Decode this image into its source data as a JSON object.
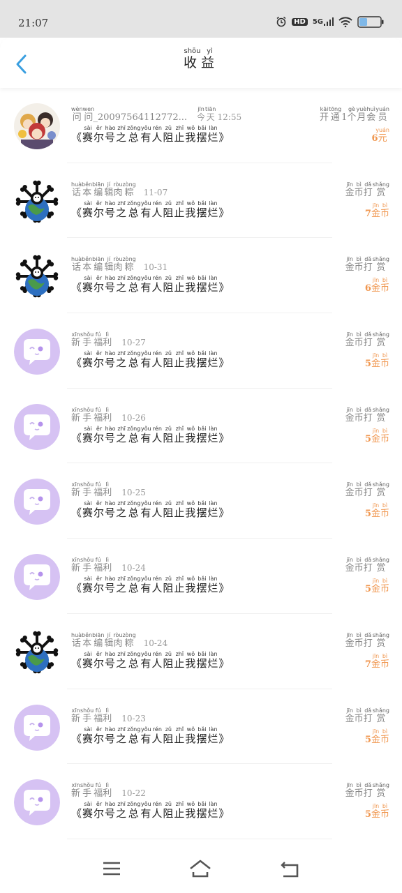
{
  "status": {
    "time": "21:07",
    "network": "5G",
    "hd": "HD"
  },
  "header": {
    "title_chars": [
      {
        "c": "收",
        "p": "shōu"
      },
      {
        "c": "益",
        "p": "yì"
      }
    ]
  },
  "book_title_chars": [
    {
      "c": "赛",
      "p": "sài"
    },
    {
      "c": "尔",
      "p": "ěr"
    },
    {
      "c": "号",
      "p": "hào"
    },
    {
      "c": "之",
      "p": "zhī"
    },
    {
      "c": "总",
      "p": "zǒng"
    },
    {
      "c": "有",
      "p": "yǒu"
    },
    {
      "c": "人",
      "p": "rén"
    },
    {
      "c": "阻",
      "p": "zǔ"
    },
    {
      "c": "止",
      "p": "zhǐ"
    },
    {
      "c": "我",
      "p": "wǒ"
    },
    {
      "c": "摆",
      "p": "bǎi"
    },
    {
      "c": "烂",
      "p": "làn"
    }
  ],
  "items": [
    {
      "avatar": "anime-group",
      "source": [
        {
          "c": "问",
          "p": "wèn"
        },
        {
          "c": "问",
          "p": "wen"
        }
      ],
      "source_suffix": "_20097564112772...",
      "time_ruby": [
        {
          "c": "今",
          "p": "jīn"
        },
        {
          "c": "天",
          "p": "tiān"
        }
      ],
      "time": "12:55",
      "type": [
        {
          "c": "开",
          "p": "kāi"
        },
        {
          "c": "通",
          "p": "tōng"
        },
        {
          "c": "1",
          "p": ""
        },
        {
          "c": "个",
          "p": "gè"
        },
        {
          "c": "月",
          "p": "yuè"
        },
        {
          "c": "会",
          "p": "huì"
        },
        {
          "c": "员",
          "p": "yuán"
        }
      ],
      "amount": "6",
      "unit": [
        {
          "c": "元",
          "p": "yuán"
        }
      ]
    },
    {
      "avatar": "bone-earth",
      "source": [
        {
          "c": "话",
          "p": "huà"
        },
        {
          "c": "本",
          "p": "běn"
        },
        {
          "c": "编",
          "p": "biān"
        },
        {
          "c": "辑",
          "p": "jí"
        },
        {
          "c": "肉",
          "p": "ròu"
        },
        {
          "c": "粽",
          "p": "zòng"
        }
      ],
      "source_suffix": "",
      "time_ruby": [],
      "time": "11-07",
      "type": [
        {
          "c": "金",
          "p": "jīn"
        },
        {
          "c": "币",
          "p": "bì"
        },
        {
          "c": "打",
          "p": "dǎ"
        },
        {
          "c": "赏",
          "p": "shǎng"
        }
      ],
      "amount": "7",
      "unit": [
        {
          "c": "金",
          "p": "jīn"
        },
        {
          "c": "币",
          "p": "bì"
        }
      ]
    },
    {
      "avatar": "bone-earth",
      "source": [
        {
          "c": "话",
          "p": "huà"
        },
        {
          "c": "本",
          "p": "běn"
        },
        {
          "c": "编",
          "p": "biān"
        },
        {
          "c": "辑",
          "p": "jí"
        },
        {
          "c": "肉",
          "p": "ròu"
        },
        {
          "c": "粽",
          "p": "zòng"
        }
      ],
      "source_suffix": "",
      "time_ruby": [],
      "time": "10-31",
      "type": [
        {
          "c": "金",
          "p": "jīn"
        },
        {
          "c": "币",
          "p": "bì"
        },
        {
          "c": "打",
          "p": "dǎ"
        },
        {
          "c": "赏",
          "p": "shǎng"
        }
      ],
      "amount": "6",
      "unit": [
        {
          "c": "金",
          "p": "jīn"
        },
        {
          "c": "币",
          "p": "bì"
        }
      ]
    },
    {
      "avatar": "purple-chat",
      "source": [
        {
          "c": "新",
          "p": "xīn"
        },
        {
          "c": "手",
          "p": "shǒu"
        },
        {
          "c": "福",
          "p": "fú"
        },
        {
          "c": "利",
          "p": "lì"
        }
      ],
      "source_suffix": "",
      "time_ruby": [],
      "time": "10-27",
      "type": [
        {
          "c": "金",
          "p": "jīn"
        },
        {
          "c": "币",
          "p": "bì"
        },
        {
          "c": "打",
          "p": "dǎ"
        },
        {
          "c": "赏",
          "p": "shǎng"
        }
      ],
      "amount": "5",
      "unit": [
        {
          "c": "金",
          "p": "jīn"
        },
        {
          "c": "币",
          "p": "bì"
        }
      ]
    },
    {
      "avatar": "purple-chat",
      "source": [
        {
          "c": "新",
          "p": "xīn"
        },
        {
          "c": "手",
          "p": "shǒu"
        },
        {
          "c": "福",
          "p": "fú"
        },
        {
          "c": "利",
          "p": "lì"
        }
      ],
      "source_suffix": "",
      "time_ruby": [],
      "time": "10-26",
      "type": [
        {
          "c": "金",
          "p": "jīn"
        },
        {
          "c": "币",
          "p": "bì"
        },
        {
          "c": "打",
          "p": "dǎ"
        },
        {
          "c": "赏",
          "p": "shǎng"
        }
      ],
      "amount": "5",
      "unit": [
        {
          "c": "金",
          "p": "jīn"
        },
        {
          "c": "币",
          "p": "bì"
        }
      ]
    },
    {
      "avatar": "purple-chat",
      "source": [
        {
          "c": "新",
          "p": "xīn"
        },
        {
          "c": "手",
          "p": "shǒu"
        },
        {
          "c": "福",
          "p": "fú"
        },
        {
          "c": "利",
          "p": "lì"
        }
      ],
      "source_suffix": "",
      "time_ruby": [],
      "time": "10-25",
      "type": [
        {
          "c": "金",
          "p": "jīn"
        },
        {
          "c": "币",
          "p": "bì"
        },
        {
          "c": "打",
          "p": "dǎ"
        },
        {
          "c": "赏",
          "p": "shǎng"
        }
      ],
      "amount": "5",
      "unit": [
        {
          "c": "金",
          "p": "jīn"
        },
        {
          "c": "币",
          "p": "bì"
        }
      ]
    },
    {
      "avatar": "purple-chat",
      "source": [
        {
          "c": "新",
          "p": "xīn"
        },
        {
          "c": "手",
          "p": "shǒu"
        },
        {
          "c": "福",
          "p": "fú"
        },
        {
          "c": "利",
          "p": "lì"
        }
      ],
      "source_suffix": "",
      "time_ruby": [],
      "time": "10-24",
      "type": [
        {
          "c": "金",
          "p": "jīn"
        },
        {
          "c": "币",
          "p": "bì"
        },
        {
          "c": "打",
          "p": "dǎ"
        },
        {
          "c": "赏",
          "p": "shǎng"
        }
      ],
      "amount": "5",
      "unit": [
        {
          "c": "金",
          "p": "jīn"
        },
        {
          "c": "币",
          "p": "bì"
        }
      ]
    },
    {
      "avatar": "bone-earth",
      "source": [
        {
          "c": "话",
          "p": "huà"
        },
        {
          "c": "本",
          "p": "běn"
        },
        {
          "c": "编",
          "p": "biān"
        },
        {
          "c": "辑",
          "p": "jí"
        },
        {
          "c": "肉",
          "p": "ròu"
        },
        {
          "c": "粽",
          "p": "zòng"
        }
      ],
      "source_suffix": "",
      "time_ruby": [],
      "time": "10-24",
      "type": [
        {
          "c": "金",
          "p": "jīn"
        },
        {
          "c": "币",
          "p": "bì"
        },
        {
          "c": "打",
          "p": "dǎ"
        },
        {
          "c": "赏",
          "p": "shǎng"
        }
      ],
      "amount": "7",
      "unit": [
        {
          "c": "金",
          "p": "jīn"
        },
        {
          "c": "币",
          "p": "bì"
        }
      ]
    },
    {
      "avatar": "purple-chat",
      "source": [
        {
          "c": "新",
          "p": "xīn"
        },
        {
          "c": "手",
          "p": "shǒu"
        },
        {
          "c": "福",
          "p": "fú"
        },
        {
          "c": "利",
          "p": "lì"
        }
      ],
      "source_suffix": "",
      "time_ruby": [],
      "time": "10-23",
      "type": [
        {
          "c": "金",
          "p": "jīn"
        },
        {
          "c": "币",
          "p": "bì"
        },
        {
          "c": "打",
          "p": "dǎ"
        },
        {
          "c": "赏",
          "p": "shǎng"
        }
      ],
      "amount": "5",
      "unit": [
        {
          "c": "金",
          "p": "jīn"
        },
        {
          "c": "币",
          "p": "bì"
        }
      ]
    },
    {
      "avatar": "purple-chat",
      "source": [
        {
          "c": "新",
          "p": "xīn"
        },
        {
          "c": "手",
          "p": "shǒu"
        },
        {
          "c": "福",
          "p": "fú"
        },
        {
          "c": "利",
          "p": "lì"
        }
      ],
      "source_suffix": "",
      "time_ruby": [],
      "time": "10-22",
      "type": [
        {
          "c": "金",
          "p": "jīn"
        },
        {
          "c": "币",
          "p": "bì"
        },
        {
          "c": "打",
          "p": "dǎ"
        },
        {
          "c": "赏",
          "p": "shǎng"
        }
      ],
      "amount": "5",
      "unit": [
        {
          "c": "金",
          "p": "jīn"
        },
        {
          "c": "币",
          "p": "bì"
        }
      ]
    }
  ],
  "navbar": {
    "icons": [
      "menu-icon",
      "home-icon",
      "back-nav-icon"
    ]
  },
  "colors": {
    "accent": "#f0964e",
    "back_arrow": "#3a9fe0",
    "avatar_purple": "#d6c2f3"
  }
}
